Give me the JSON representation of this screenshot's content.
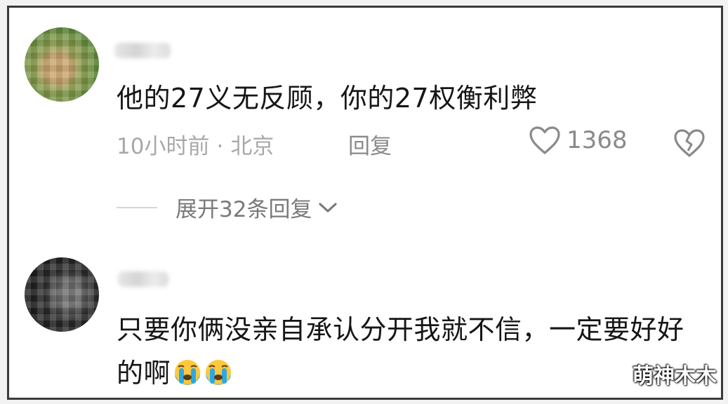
{
  "comment1": {
    "text": "他的27义无反顾，你的27权衡利弊",
    "time": "10小时前",
    "separator": "·",
    "location": "北京",
    "reply_label": "回复",
    "like_count": "1368",
    "expand_label": "展开32条回复"
  },
  "comment2": {
    "text": "只要你俩没亲自承认分开我就不信，一定要好好的啊",
    "emoji": [
      "crying-face",
      "crying-face"
    ]
  },
  "watermark": "萌神木木",
  "colors": {
    "text_primary": "#161616",
    "text_secondary": "#a8a8a8",
    "icon_gray": "#8a8a8a",
    "emoji_blue": "#2aa8e8",
    "emoji_yellow": "#ffc83a"
  }
}
